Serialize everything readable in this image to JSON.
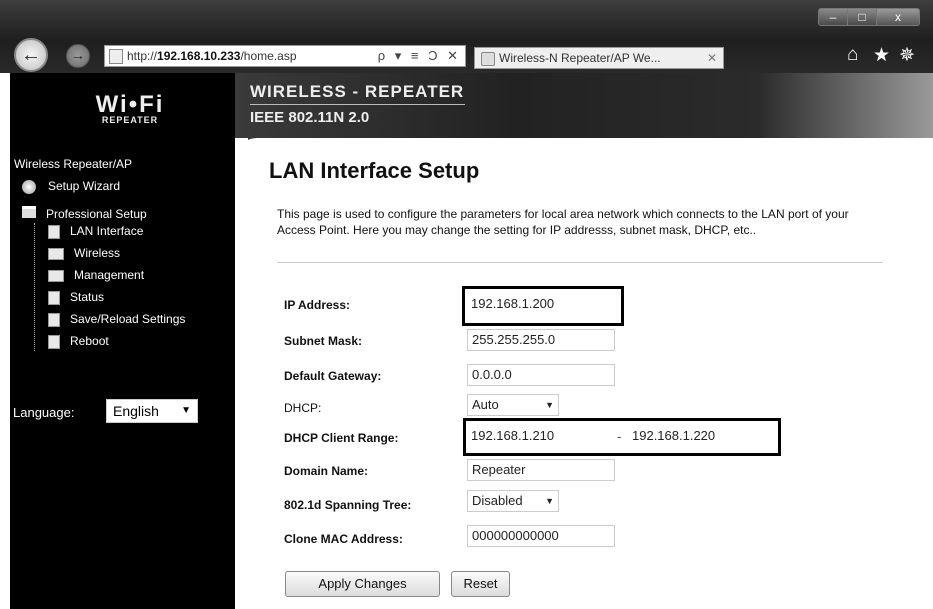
{
  "browser": {
    "url_prefix": "http://",
    "url_host": "192.168.10.233",
    "url_path": "/home.asp",
    "url_tools": "ρ ▾ ≡ Ɔ ✕",
    "tab_title": "Wireless-N Repeater/AP We...",
    "tab_close": "✕",
    "window_buttons": {
      "minimize": "–",
      "maximize": "□",
      "close": "x"
    },
    "back_icon": "←",
    "forward_icon": "→",
    "toolbar_icons": {
      "home": "⌂",
      "favorites": "★",
      "settings": "✵"
    }
  },
  "banner": {
    "logo_main": "Wi•Fi",
    "logo_sub": "REPEATER",
    "title": "WIRELESS - REPEATER",
    "subtitle": "IEEE 802.11N 2.0"
  },
  "sidebar": {
    "title": "Wireless Repeater/AP",
    "setup_wizard": "Setup Wizard",
    "professional_setup": "Professional Setup",
    "items": [
      {
        "label": "LAN Interface"
      },
      {
        "label": "Wireless"
      },
      {
        "label": "Management"
      },
      {
        "label": "Status"
      },
      {
        "label": "Save/Reload Settings"
      },
      {
        "label": "Reboot"
      }
    ],
    "language_label": "Language:",
    "language_value": "English",
    "select_arrow": "▼"
  },
  "content": {
    "heading": "LAN Interface Setup",
    "description": "This page is used to configure the parameters for local area network which connects to the LAN port of your Access Point. Here you may change the setting for IP addresss, subnet mask, DHCP, etc..",
    "fields": {
      "ip_label": "IP Address:",
      "ip_value": "192.168.1.200",
      "subnet_label": "Subnet Mask:",
      "subnet_value": "255.255.255.0",
      "gateway_label": "Default Gateway:",
      "gateway_value": "0.0.0.0",
      "dhcp_label": "DHCP:",
      "dhcp_value": "Auto",
      "range_label": "DHCP Client Range:",
      "range_start": "192.168.1.210",
      "range_sep": "-",
      "range_end": "192.168.1.220",
      "domain_label": "Domain Name:",
      "domain_value": "Repeater",
      "stp_label": "802.1d Spanning Tree:",
      "stp_value": "Disabled",
      "mac_label": "Clone MAC Address:",
      "mac_value": "000000000000"
    },
    "select_arrow": "▼",
    "apply_button": "Apply Changes",
    "reset_button": "Reset"
  }
}
